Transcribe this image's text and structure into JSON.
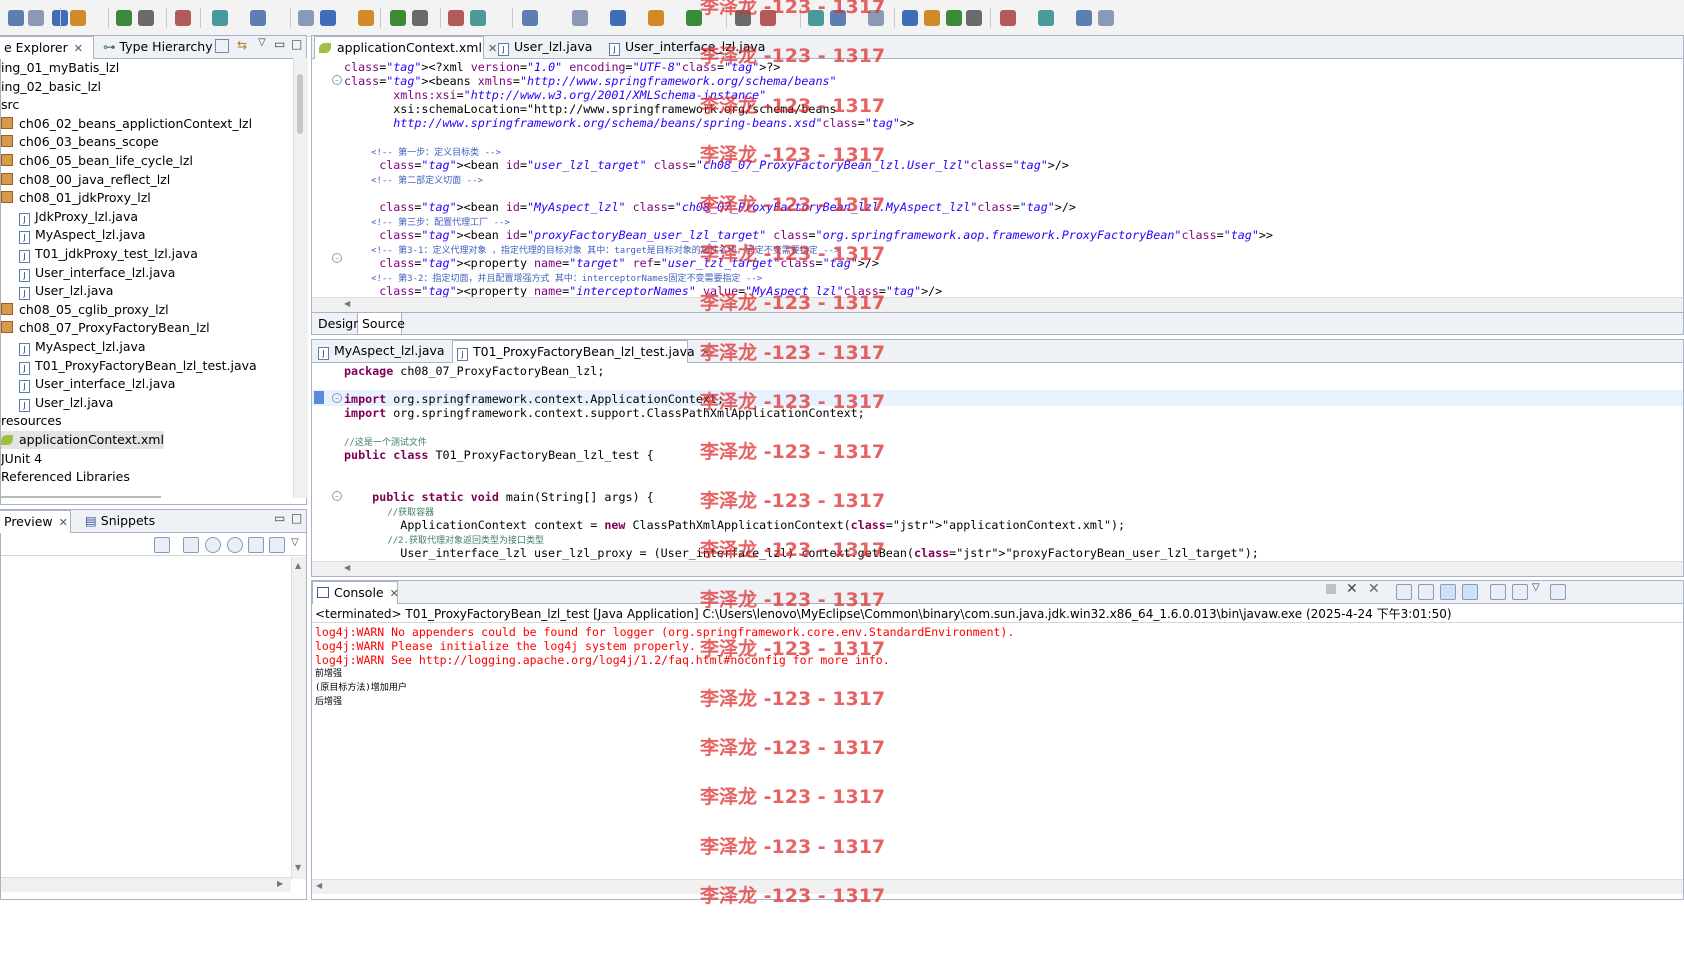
{
  "explorer": {
    "tabs": [
      {
        "label": "e Explorer"
      },
      {
        "label": "Type Hierarchy"
      }
    ],
    "items": [
      {
        "label": "ing_01_myBatis_lzl",
        "indent": 0,
        "icon": "project-icon"
      },
      {
        "label": "ing_02_basic_lzl",
        "indent": 0,
        "icon": "project-icon"
      },
      {
        "label": "src",
        "indent": 0,
        "icon": "folder-icon"
      },
      {
        "label": "ch06_02_beans_applictionContext_lzl",
        "indent": 1,
        "icon": "package-icon"
      },
      {
        "label": "ch06_03_beans_scope",
        "indent": 1,
        "icon": "package-icon"
      },
      {
        "label": "ch06_05_bean_life_cycle_lzl",
        "indent": 1,
        "icon": "package-icon"
      },
      {
        "label": "ch08_00_java_reflect_lzl",
        "indent": 1,
        "icon": "package-icon"
      },
      {
        "label": "ch08_01_jdkProxy_lzl",
        "indent": 1,
        "icon": "package-icon"
      },
      {
        "label": "JdkProxy_lzl.java",
        "indent": 2,
        "icon": "java-file-icon"
      },
      {
        "label": "MyAspect_lzl.java",
        "indent": 2,
        "icon": "java-file-icon"
      },
      {
        "label": "T01_jdkProxy_test_lzl.java",
        "indent": 2,
        "icon": "java-file-icon"
      },
      {
        "label": "User_interface_lzl.java",
        "indent": 2,
        "icon": "java-file-icon"
      },
      {
        "label": "User_lzl.java",
        "indent": 2,
        "icon": "java-file-icon"
      },
      {
        "label": "ch08_05_cglib_proxy_lzl",
        "indent": 1,
        "icon": "package-icon"
      },
      {
        "label": "ch08_07_ProxyFactoryBean_lzl",
        "indent": 1,
        "icon": "package-icon"
      },
      {
        "label": "MyAspect_lzl.java",
        "indent": 2,
        "icon": "java-file-icon"
      },
      {
        "label": "T01_ProxyFactoryBean_lzl_test.java",
        "indent": 2,
        "icon": "java-file-icon"
      },
      {
        "label": "User_interface_lzl.java",
        "indent": 2,
        "icon": "java-file-icon"
      },
      {
        "label": "User_lzl.java",
        "indent": 2,
        "icon": "java-file-icon"
      },
      {
        "label": "resources",
        "indent": 0,
        "icon": "folder-icon"
      },
      {
        "label": "applicationContext.xml",
        "indent": 1,
        "icon": "xml-file-icon",
        "selected": true
      },
      {
        "label": "JUnit 4",
        "indent": 0,
        "icon": "library-icon"
      },
      {
        "label": "Referenced Libraries",
        "indent": 0,
        "icon": "library-icon"
      }
    ]
  },
  "preview": {
    "tabs": [
      {
        "label": "Preview"
      },
      {
        "label": "Snippets"
      }
    ]
  },
  "xml_editor": {
    "tabs": [
      {
        "label": "applicationContext.xml"
      },
      {
        "label": "User_lzl.java"
      },
      {
        "label": "User_interface_lzl.java"
      }
    ],
    "bottom_tabs": [
      {
        "label": "Design"
      },
      {
        "label": "Source"
      }
    ],
    "lines": [
      "<?xml version=\"1.0\" encoding=\"UTF-8\"?>",
      "<beans xmlns=\"http://www.springframework.org/schema/beans\"",
      "       xmlns:xsi=\"http://www.w3.org/2001/XMLSchema-instance\"",
      "       xsi:schemaLocation=\"http://www.springframework.org/schema/beans",
      "       http://www.springframework.org/schema/beans/spring-beans.xsd\">",
      "",
      "     <!-- 第一步：定义目标类 -->",
      "     <bean id=\"user_lzl_target\" class=\"ch08_07_ProxyFactoryBean_lzl.User_lzl\"/>",
      "     <!-- 第二部定义切面 -->",
      "",
      "     <bean id=\"MyAspect_lzl\" class=\"ch08_07_ProxyFactoryBean_lzl.MyAspect_lzl\"/>",
      "     <!-- 第三步：配置代理工厂 -->",
      "     <bean id=\"proxyFactoryBean_user_lzl_target\" class=\"org.springframework.aop.framework.ProxyFactoryBean\">",
      "     <!-- 第3-1：定义代理对象 ，指定代理的目标对象 其中：target是目标对象的属性名称，固定不变需要指定 -->",
      "     <property name=\"target\" ref=\"user_lzl_target\"/>",
      "     <!-- 第3-2：指定切面，并且配置增强方式 其中：interceptorNames固定不变需要指定 -->",
      "     <property name=\"interceptorNames\" value=\"MyAspect_lzl\"/>"
    ]
  },
  "java_editor": {
    "tabs": [
      {
        "label": "MyAspect_lzl.java"
      },
      {
        "label": "T01_ProxyFactoryBean_lzl_test.java"
      }
    ],
    "lines": [
      "package ch08_07_ProxyFactoryBean_lzl;",
      "",
      "import org.springframework.context.ApplicationContext;",
      "import org.springframework.context.support.ClassPathXmlApplicationContext;",
      "",
      "//这是一个测试文件",
      "public class T01_ProxyFactoryBean_lzl_test {",
      "",
      "",
      "    public static void main(String[] args) {",
      "        //获取容器",
      "        ApplicationContext context = new ClassPathXmlApplicationContext(\"applicationContext.xml\");",
      "        //2.获取代理对象返回类型为接口类型",
      "        User_interface_lzl user_lzl_proxy = (User_interface_lzl) context.getBean(\"proxyFactoryBean_user_lzl_target\");"
    ]
  },
  "console": {
    "tab_label": "Console",
    "status": "<terminated> T01_ProxyFactoryBean_lzl_test [Java Application] C:\\Users\\lenovo\\MyEclipse\\Common\\binary\\com.sun.java.jdk.win32.x86_64_1.6.0.013\\bin\\javaw.exe (2025-4-24 下午3:01:50)",
    "lines": [
      {
        "text": "log4j:WARN No appenders could be found for logger (org.springframework.core.env.StandardEnvironment).",
        "level": "warn"
      },
      {
        "text": "log4j:WARN Please initialize the log4j system properly.",
        "level": "warn"
      },
      {
        "text": "log4j:WARN See http://logging.apache.org/log4j/1.2/faq.html#noconfig for more info.",
        "level": "warn"
      },
      {
        "text": "前增强",
        "level": "out"
      },
      {
        "text": "(原目标方法)增加用户",
        "level": "out"
      },
      {
        "text": "后增强",
        "level": "out"
      }
    ]
  },
  "watermark": "李泽龙 -123 - 1317",
  "colors": {
    "warn": "#ff0000",
    "watermark": "#e03030",
    "accent_border": "#a9b3c3"
  }
}
